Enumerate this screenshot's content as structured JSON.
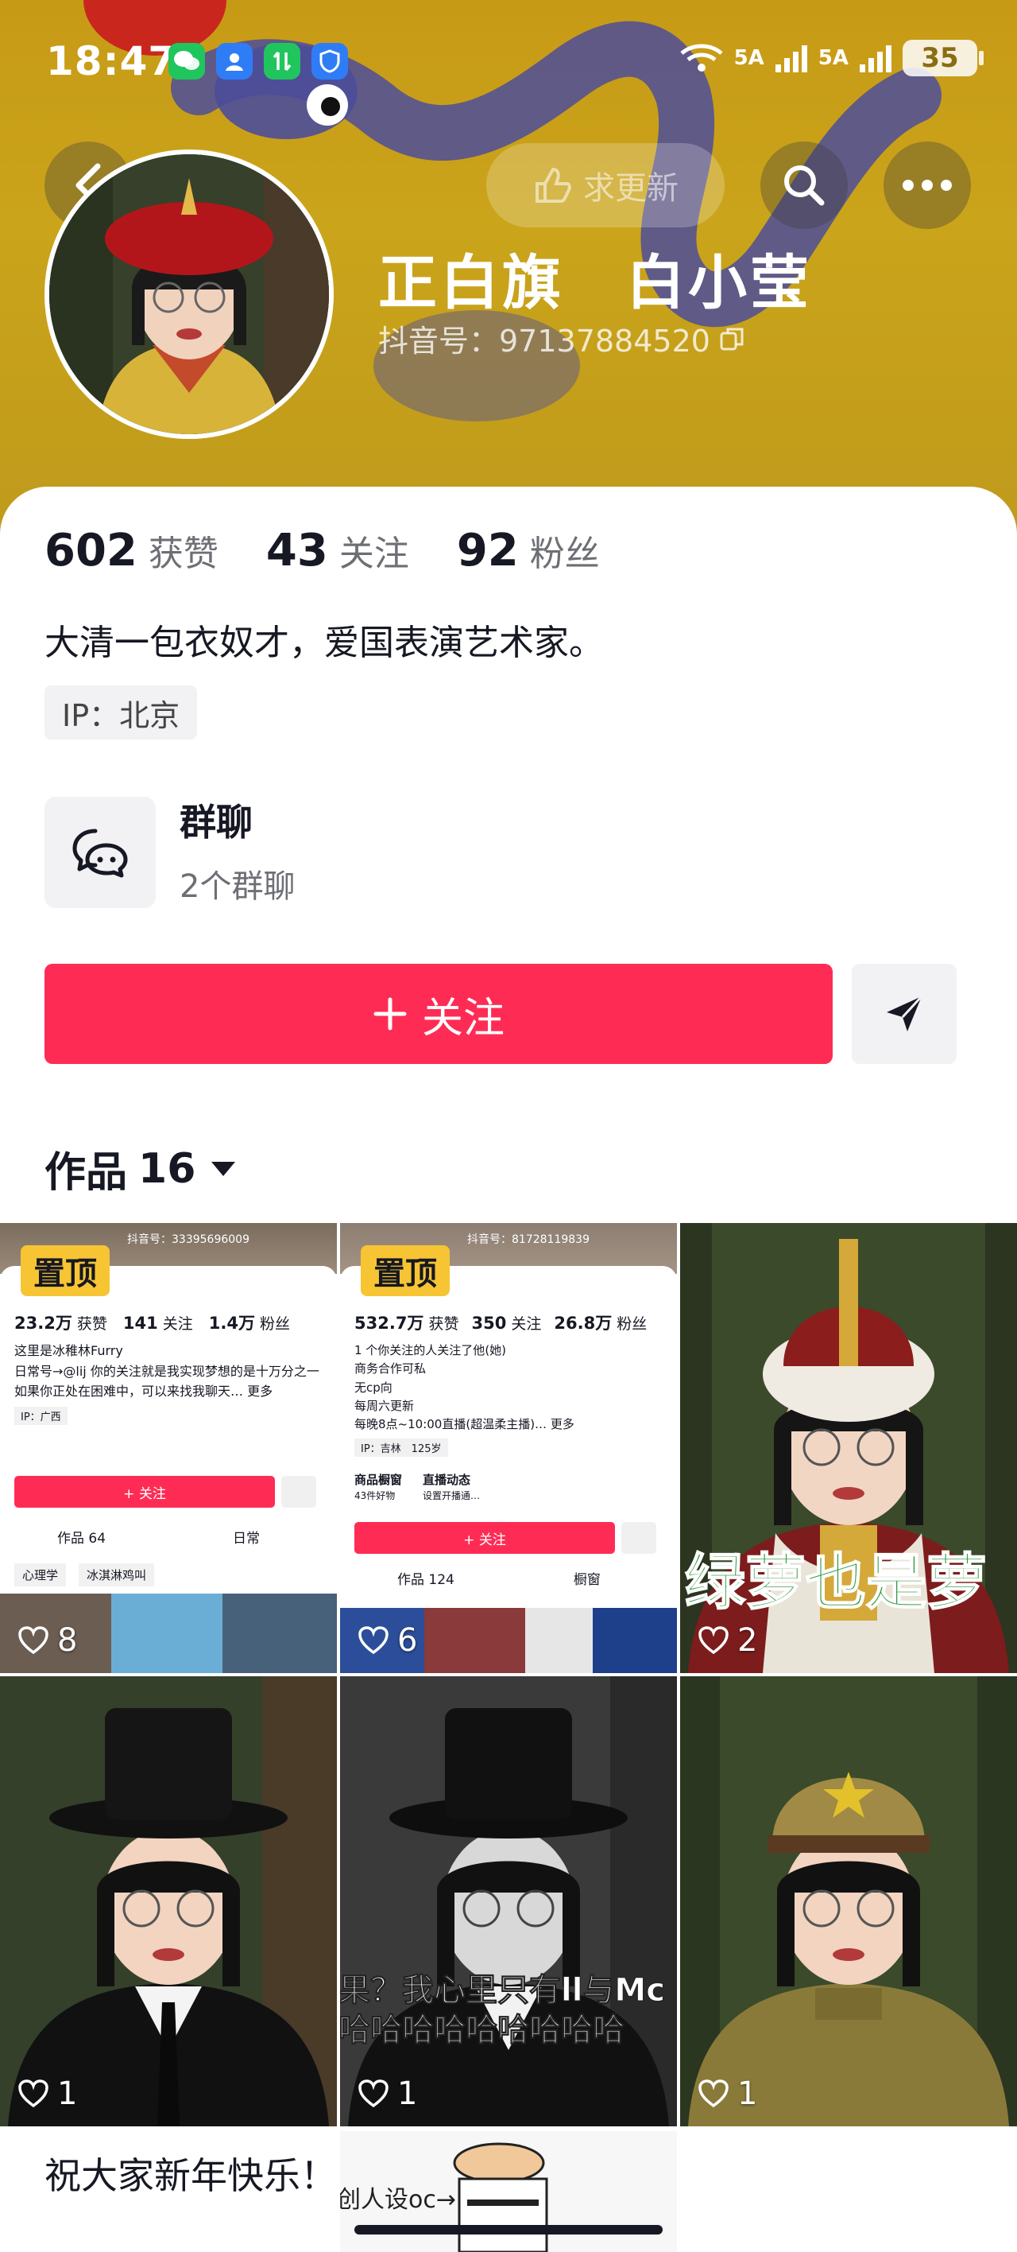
{
  "status_bar": {
    "time": "18:47",
    "network_1": "5A",
    "network_2": "5A",
    "battery": "35"
  },
  "header": {
    "update_label": "求更新",
    "name": "正白旗　白小莹",
    "douyin_id": "抖音号：97137884520"
  },
  "stats": [
    {
      "value": "602",
      "label": "获赞"
    },
    {
      "value": "43",
      "label": "关注"
    },
    {
      "value": "92",
      "label": "粉丝"
    }
  ],
  "bio": "大清一包衣奴才，爱国表演艺术家。",
  "ip": "IP：北京",
  "group": {
    "title": "群聊",
    "subtitle": "2个群聊"
  },
  "follow_label": "关注",
  "works": {
    "label": "作品",
    "count": "16"
  },
  "tiles": [
    {
      "pin": "置顶",
      "likes": "8",
      "mini": {
        "id": "抖音号：33395696009",
        "stats": [
          {
            "v": "23.2万",
            "l": "获赞"
          },
          {
            "v": "141",
            "l": "关注"
          },
          {
            "v": "1.4万",
            "l": "粉丝"
          }
        ],
        "lines": [
          "这里是冰稚林Furry",
          "日常号→@lij 你的关注就是我实现梦想的是十万分之一",
          "如果你正处在困难中，可以来找我聊天… 更多"
        ],
        "ip": "IP：广西",
        "follow": "+ 关注",
        "tab1": "作品 64",
        "tab2": "日常",
        "chip1": "心理学",
        "chip2": "冰淇淋鸡叫"
      }
    },
    {
      "pin": "置顶",
      "likes": "6",
      "mini": {
        "id": "抖音号：81728119839",
        "stats": [
          {
            "v": "532.7万",
            "l": "获赞"
          },
          {
            "v": "350",
            "l": "关注"
          },
          {
            "v": "26.8万",
            "l": "粉丝"
          }
        ],
        "lines": [
          "1 个你关注的人关注了他(她)",
          "商务合作可私",
          "无cp向",
          "每周六更新",
          "每晚8点~10:00直播(超温柔主播)… 更多"
        ],
        "ip": "IP：吉林　125岁",
        "shop": "商品橱窗",
        "shop_sub": "43件好物",
        "live": "直播动态",
        "live_sub": "设置开播通…",
        "follow": "+ 关注",
        "tab1": "作品 124",
        "tab2": "橱窗"
      }
    },
    {
      "likes": "2",
      "overlay": "绿萝也是萝"
    },
    {
      "likes": "1"
    },
    {
      "likes": "1",
      "overlay": "果？我心里只有ll与Mc",
      "overlay2": "哈哈哈哈哈哈哈哈哈"
    },
    {
      "likes": "1"
    }
  ],
  "bottom": {
    "caption": "祝大家新年快乐！",
    "caption2": "创人设oc→"
  },
  "colors": {
    "accent": "#fe2c55",
    "header_gold": "#c79a16",
    "pin_yellow": "#f7c533"
  }
}
